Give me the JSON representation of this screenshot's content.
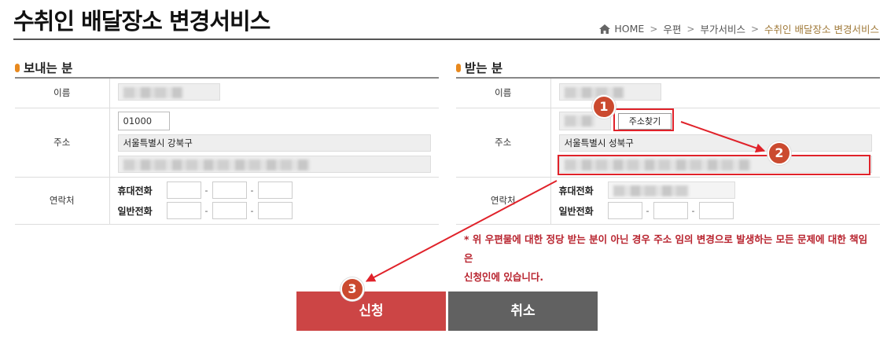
{
  "page": {
    "title": "수취인 배달장소 변경서비스"
  },
  "breadcrumb": {
    "home": "HOME",
    "sep": ">",
    "items": [
      "우편",
      "부가서비스"
    ],
    "current": "수취인 배달장소 변경서비스"
  },
  "sender": {
    "section_title": "보내는 분",
    "name_label": "이름",
    "address_label": "주소",
    "zipcode": "01000",
    "address1": "서울특별시 강북구",
    "contact_label": "연락처",
    "mobile_label": "휴대전화",
    "landline_label": "일반전화",
    "dash": "-"
  },
  "receiver": {
    "section_title": "받는 분",
    "name_label": "이름",
    "address_label": "주소",
    "find_address_button": "주소찾기",
    "address1": "서울특별시 성북구",
    "contact_label": "연락처",
    "mobile_label": "휴대전화",
    "landline_label": "일반전화",
    "dash": "-"
  },
  "notice": {
    "line1": "* 위 우편물에 대한 정당 받는 분이 아닌 경우 주소 임의 변경으로 발생하는 모든 문제에 대한 책임은",
    "line2": "신청인에 있습니다."
  },
  "buttons": {
    "apply": "신청",
    "cancel": "취소"
  },
  "markers": [
    "1",
    "2",
    "3"
  ],
  "colors": {
    "accent_red": "#e0222a",
    "marker": "#cb4a2f",
    "apply_btn": "#cc4545",
    "cancel_btn": "#616161",
    "notice": "#b8232e",
    "bullet": "#e8891e"
  }
}
